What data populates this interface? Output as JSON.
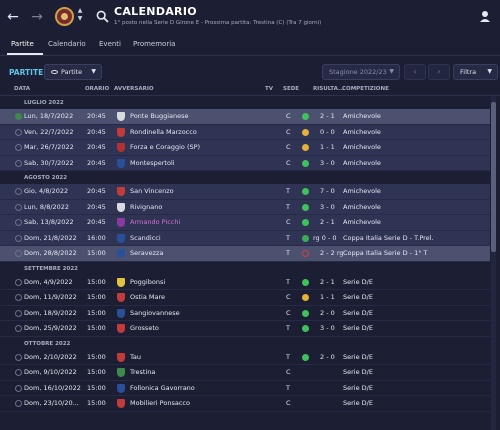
{
  "header": {
    "title": "CALENDARIO",
    "subtitle": "1° posto nella Serie D Girone E - Prossima partita: Trestina (C) (Tra 7 giorni)"
  },
  "tabs": [
    {
      "label": "Partite",
      "active": true
    },
    {
      "label": "Calendario",
      "active": false
    },
    {
      "label": "Eventi",
      "active": false
    },
    {
      "label": "Promemoria",
      "active": false
    }
  ],
  "toolbar": {
    "section_title": "PARTITE",
    "view_label": "Partite",
    "season_label": "Stagione 2022/23",
    "filter_label": "Filtra"
  },
  "columns": {
    "data": "DATA",
    "orario": "ORARIO",
    "avversario": "AVVERSARIO",
    "tv": "TV",
    "sede": "SEDE",
    "risultato": "RISULTA...",
    "competizione": "COMPETIZIONE"
  },
  "months": [
    "LUGLIO 2022",
    "AGOSTO 2022",
    "SETTEMBRE 2022",
    "OTTOBRE 2022"
  ],
  "matches": [
    {
      "date": "Lun, 18/7/2022",
      "time": "20:45",
      "opponent": "Ponte Buggianese",
      "venue": "C",
      "result": "2 - 1",
      "outcome": "win",
      "competition": "Amichevole",
      "crest_color": "#d9d9e0"
    },
    {
      "date": "Ven, 22/7/2022",
      "time": "20:45",
      "opponent": "Rondinella Marzocco",
      "venue": "C",
      "result": "0 - 0",
      "outcome": "draw",
      "competition": "Amichevole",
      "crest_color": "#c23a3a"
    },
    {
      "date": "Mar, 26/7/2022",
      "time": "20:45",
      "opponent": "Forza e Coraggio (SP)",
      "venue": "C",
      "result": "1 - 1",
      "outcome": "draw",
      "competition": "Amichevole",
      "crest_color": "#b33030"
    },
    {
      "date": "Sab, 30/7/2022",
      "time": "20:45",
      "opponent": "Montespertoli",
      "venue": "C",
      "result": "3 - 0",
      "outcome": "win",
      "competition": "Amichevole",
      "crest_color": "#2a4f9a"
    },
    {
      "date": "Gio, 4/8/2022",
      "time": "20:45",
      "opponent": "San Vincenzo",
      "venue": "T",
      "result": "7 - 0",
      "outcome": "win",
      "competition": "Amichevole",
      "crest_color": "#c23a3a"
    },
    {
      "date": "Lun, 8/8/2022",
      "time": "20:45",
      "opponent": "Rivignano",
      "venue": "T",
      "result": "3 - 0",
      "outcome": "win",
      "competition": "Amichevole",
      "crest_color": "#d9d9e0"
    },
    {
      "date": "Sab, 13/8/2022",
      "time": "20:45",
      "opponent": "Armando Picchi",
      "venue": "C",
      "result": "2 - 1",
      "outcome": "win",
      "competition": "Amichevole",
      "crest_color": "#8a3aa0"
    },
    {
      "date": "Dom, 21/8/2022",
      "time": "16:00",
      "opponent": "Scandicci",
      "venue": "T",
      "result": "rg 0 - 0",
      "outcome": "pend",
      "competition": "Coppa Italia Serie D - T.Prel.",
      "crest_color": "#2a4f9a"
    },
    {
      "date": "Dom, 28/8/2022",
      "time": "15:00",
      "opponent": "Seravezza",
      "venue": "T",
      "result": "2 - 2 rg",
      "outcome": "open",
      "competition": "Coppa Italia Serie D - 1° T",
      "crest_color": "#2a4f9a"
    },
    {
      "date": "Dom, 4/9/2022",
      "time": "15:00",
      "opponent": "Poggibonsi",
      "venue": "T",
      "result": "2 - 1",
      "outcome": "win",
      "competition": "Serie D/E",
      "crest_color": "#e2c23a"
    },
    {
      "date": "Dom, 11/9/2022",
      "time": "15:00",
      "opponent": "Ostia Mare",
      "venue": "C",
      "result": "1 - 1",
      "outcome": "draw",
      "competition": "Serie D/E",
      "crest_color": "#c23a3a"
    },
    {
      "date": "Dom, 18/9/2022",
      "time": "15:00",
      "opponent": "Sangiovannese",
      "venue": "C",
      "result": "2 - 0",
      "outcome": "win",
      "competition": "Serie D/E",
      "crest_color": "#2a4f9a"
    },
    {
      "date": "Dom, 25/9/2022",
      "time": "15:00",
      "opponent": "Grosseto",
      "venue": "T",
      "result": "3 - 0",
      "outcome": "win",
      "competition": "Serie D/E",
      "crest_color": "#c23a3a"
    },
    {
      "date": "Dom, 2/10/2022",
      "time": "15:00",
      "opponent": "Tau",
      "venue": "T",
      "result": "2 - 0",
      "outcome": "win",
      "competition": "Serie D/E",
      "crest_color": "#c23a3a"
    },
    {
      "date": "Dom, 9/10/2022",
      "time": "15:00",
      "opponent": "Trestina",
      "venue": "C",
      "result": "",
      "outcome": "none",
      "competition": "Serie D/E",
      "crest_color": "#3d8a4a"
    },
    {
      "date": "Dom, 16/10/2022",
      "time": "15:00",
      "opponent": "Follonica Gavorrano",
      "venue": "T",
      "result": "",
      "outcome": "none",
      "competition": "Serie D/E",
      "crest_color": "#2a4f9a"
    },
    {
      "date": "Dom, 23/10/20...",
      "time": "15:00",
      "opponent": "Mobilieri Ponsacco",
      "venue": "C",
      "result": "",
      "outcome": "none",
      "competition": "Serie D/E",
      "crest_color": "#c23a3a"
    }
  ]
}
